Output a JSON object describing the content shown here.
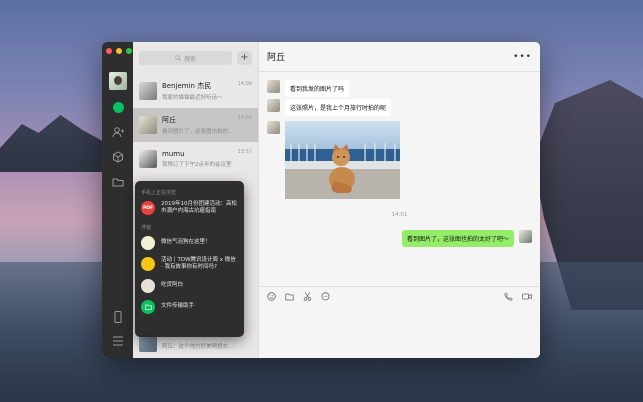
{
  "search": {
    "placeholder": "搜索",
    "add_label": "+"
  },
  "chats": [
    {
      "name": "Benjemin 杰民",
      "preview": "我家的猫猫最近好听话～",
      "time": "14:09"
    },
    {
      "name": "阿丘",
      "preview": "看到图片了，这张图也拍的...",
      "time": "14:01"
    },
    {
      "name": "mumu",
      "preview": "我预订了下午2点半的会议室",
      "time": "13:57"
    }
  ],
  "hidden_chat_preview": "阿丘：这个地方好美啊想去...",
  "popup": {
    "section1": "手机上正在浏览",
    "doc_item": {
      "badge": "PDF",
      "text": "2019年10月份团建活动：高松市潮户内海古坑瘤指南"
    },
    "section2": "浮窗",
    "items": [
      {
        "text": "微信气泡狗在这里！"
      },
      {
        "text": "活动丨TDW腾讯设计周 x 微信 · 我有故事你有时间吗?"
      },
      {
        "text": "吃货阿白"
      },
      {
        "text": "文件传输助手"
      }
    ]
  },
  "conversation": {
    "title": "阿丘",
    "more_label": "•••",
    "messages": [
      {
        "text": "看到我发的图片了吗"
      },
      {
        "text": "这张照片，是我上个月旅行时拍的呢"
      }
    ],
    "timestamp": "14:01",
    "reply": "看到图片了，这张图也拍的太好了吧～"
  },
  "toolbar": {
    "icons": [
      "emoji-icon",
      "folder-icon",
      "scissors-icon",
      "chat-bubble-icon",
      "phone-icon",
      "video-icon"
    ]
  },
  "colors": {
    "accent": "#07c160",
    "bubble_me": "#95ec69",
    "sidebar": "#2e2e2e"
  }
}
